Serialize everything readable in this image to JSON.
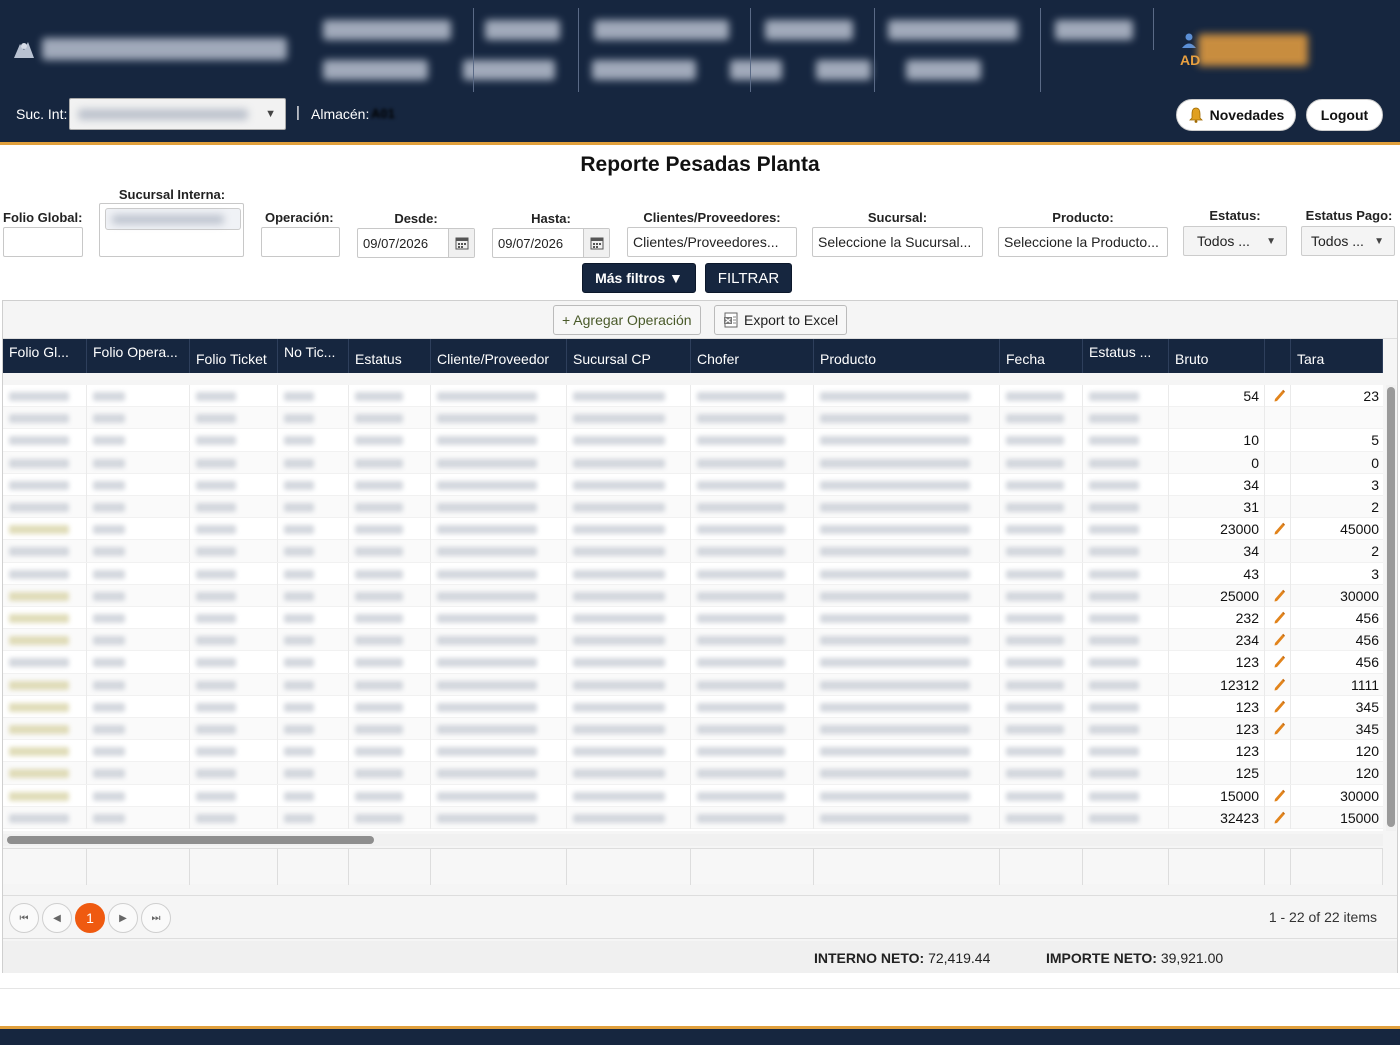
{
  "header": {
    "suc_label": "Suc. Int:",
    "pipe": "|",
    "almacen_label": "Almacén:",
    "almacen_value": "A01",
    "user_prefix": "AD",
    "novedades": "Novedades",
    "logout": "Logout"
  },
  "title": "Reporte Pesadas Planta",
  "filters": {
    "folio_global": "Folio Global:",
    "sucursal_interna": "Sucursal Interna:",
    "operacion": "Operación:",
    "desde": "Desde:",
    "desde_value": "09/07/2026",
    "hasta": "Hasta:",
    "hasta_value": "09/07/2026",
    "clientes": "Clientes/Proveedores:",
    "clientes_placeholder": "Clientes/Proveedores...",
    "sucursal": "Sucursal:",
    "sucursal_placeholder": "Seleccione la Sucursal...",
    "producto": "Producto:",
    "producto_placeholder": "Seleccione la Producto...",
    "estatus": "Estatus:",
    "estatus_value": "Todos ...",
    "estatus_pago": "Estatus Pago:",
    "estatus_pago_value": "Todos ...",
    "mas_filtros": "Más filtros ▼",
    "filtrar": "FILTRAR"
  },
  "toolbar": {
    "agregar": "+ Agregar Operación",
    "export": "Export to Excel"
  },
  "columns": [
    "Folio Gl...",
    "Folio Opera...",
    "Folio Ticket",
    "No Tic...",
    "Estatus",
    "Cliente/Proveedor",
    "Sucursal CP",
    "Chofer",
    "Producto",
    "Fecha",
    "Estatus ...",
    "Bruto",
    "Tara"
  ],
  "rows": [
    {
      "bruto": "54",
      "tara": "23",
      "edit": true
    },
    {
      "bruto": "",
      "tara": "",
      "edit": false
    },
    {
      "bruto": "10",
      "tara": "5",
      "edit": false
    },
    {
      "bruto": "0",
      "tara": "0",
      "edit": false
    },
    {
      "bruto": "34",
      "tara": "3",
      "edit": false
    },
    {
      "bruto": "31",
      "tara": "2",
      "edit": false
    },
    {
      "bruto": "23000",
      "tara": "45000",
      "edit": true
    },
    {
      "bruto": "34",
      "tara": "2",
      "edit": false
    },
    {
      "bruto": "43",
      "tara": "3",
      "edit": false
    },
    {
      "bruto": "25000",
      "tara": "30000",
      "edit": true
    },
    {
      "bruto": "232",
      "tara": "456",
      "edit": true
    },
    {
      "bruto": "234",
      "tara": "456",
      "edit": true
    },
    {
      "bruto": "123",
      "tara": "456",
      "edit": true
    },
    {
      "bruto": "12312",
      "tara": "1111",
      "edit": true
    },
    {
      "bruto": "123",
      "tara": "345",
      "edit": true
    },
    {
      "bruto": "123",
      "tara": "345",
      "edit": true
    },
    {
      "bruto": "123",
      "tara": "120",
      "edit": false
    },
    {
      "bruto": "125",
      "tara": "120",
      "edit": false
    },
    {
      "bruto": "15000",
      "tara": "30000",
      "edit": true
    },
    {
      "bruto": "32423",
      "tara": "15000",
      "edit": true
    }
  ],
  "pager": {
    "first": "⏮",
    "prev": "◀",
    "page": "1",
    "next": "▶",
    "last": "⏭",
    "info": "1 - 22 of 22 items"
  },
  "totals": {
    "interno_label": "INTERNO NETO:",
    "interno_value": "72,419.44",
    "importe_label": "IMPORTE NETO:",
    "importe_value": "39,921.00"
  },
  "colors": {
    "navy": "#16263f",
    "accent_orange": "#e1a03c",
    "page_active": "#ef5a10"
  }
}
